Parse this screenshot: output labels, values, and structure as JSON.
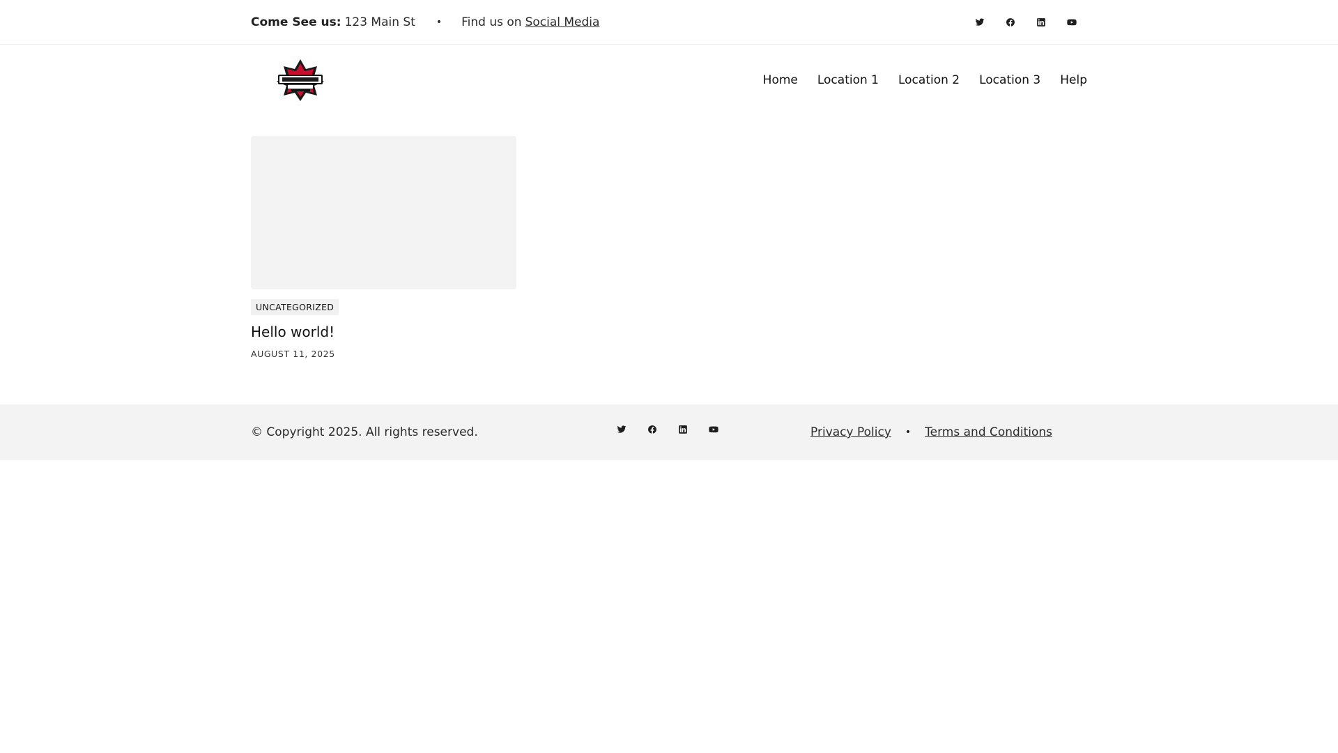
{
  "topbar": {
    "visit_label": "Come See us:",
    "address": "123 Main St",
    "separator": "•",
    "find_us_text": "Find us on",
    "social_link": "Social Media",
    "social_icons": [
      "twitter-icon",
      "facebook-icon",
      "linkedin-icon",
      "youtube-icon"
    ]
  },
  "header": {
    "nav": [
      "Home",
      "Location 1",
      "Location 2",
      "Location 3",
      "Help"
    ]
  },
  "post": {
    "category": "UNCATEGORIZED",
    "title": "Hello world!",
    "date": "AUGUST 11, 2025"
  },
  "footer": {
    "copyright": "© Copyright 2025. All rights reserved.",
    "separator": "•",
    "privacy": "Privacy Policy",
    "terms": "Terms and Conditions",
    "social_icons": [
      "twitter-icon",
      "facebook-icon",
      "linkedin-icon",
      "youtube-icon"
    ]
  },
  "colors": {
    "footer_bg": "#f3f3f3",
    "logo_red": "#c8102e",
    "text": "#1e1e1e"
  }
}
